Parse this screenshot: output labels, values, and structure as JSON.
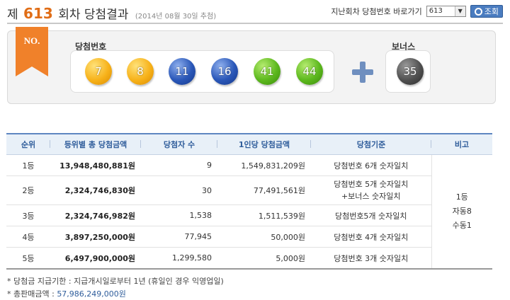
{
  "header": {
    "prefix": "제",
    "round": "613",
    "suffix": "회차 당첨결과",
    "date": "(2014년 08월 30일 추첨)",
    "goto_label": "지난회차 당첨번호 바로가기",
    "select_value": "613",
    "search_button": "조회"
  },
  "draw": {
    "badge": "NO.",
    "winning_label": "당첨번호",
    "bonus_label": "보너스",
    "numbers": [
      {
        "value": "7",
        "color": "yellow"
      },
      {
        "value": "8",
        "color": "yellow"
      },
      {
        "value": "11",
        "color": "blue"
      },
      {
        "value": "16",
        "color": "blue"
      },
      {
        "value": "41",
        "color": "green"
      },
      {
        "value": "44",
        "color": "green"
      }
    ],
    "bonus": {
      "value": "35",
      "color": "dark"
    }
  },
  "table": {
    "headers": [
      "순위",
      "등위별 총 당첨금액",
      "당첨자 수",
      "1인당 당첨금액",
      "당첨기준",
      "비고"
    ],
    "rows": [
      {
        "rank": "1등",
        "total": "13,948,480,881원",
        "winners": "9",
        "per": "1,549,831,209원",
        "criteria": "당첨번호 6개 숫자일치",
        "criteria2": ""
      },
      {
        "rank": "2등",
        "total": "2,324,746,830원",
        "winners": "30",
        "per": "77,491,561원",
        "criteria": "당첨번호 5개 숫자일치",
        "criteria2": "+보너스 숫자일치"
      },
      {
        "rank": "3등",
        "total": "2,324,746,982원",
        "winners": "1,538",
        "per": "1,511,539원",
        "criteria": "당첨번호5개 숫자일치",
        "criteria2": ""
      },
      {
        "rank": "4등",
        "total": "3,897,250,000원",
        "winners": "77,945",
        "per": "50,000원",
        "criteria": "당첨번호 4개 숫자일치",
        "criteria2": ""
      },
      {
        "rank": "5등",
        "total": "6,497,900,000원",
        "winners": "1,299,580",
        "per": "5,000원",
        "criteria": "당첨번호 3개 숫자일치",
        "criteria2": ""
      }
    ],
    "note": [
      "1등",
      "자동8",
      "수동1"
    ]
  },
  "footer": {
    "period_label": "* 당첨금 지급기한 : 지급개시일로부터 1년 (휴일인 경우 익영업일)",
    "sales_label": "* 총판매금액 :",
    "sales_value": "57,986,249,000원"
  },
  "colors": {
    "accent_orange": "#e06d16",
    "header_blue": "#2f5d9b",
    "button_blue": "#4a7cc0"
  }
}
